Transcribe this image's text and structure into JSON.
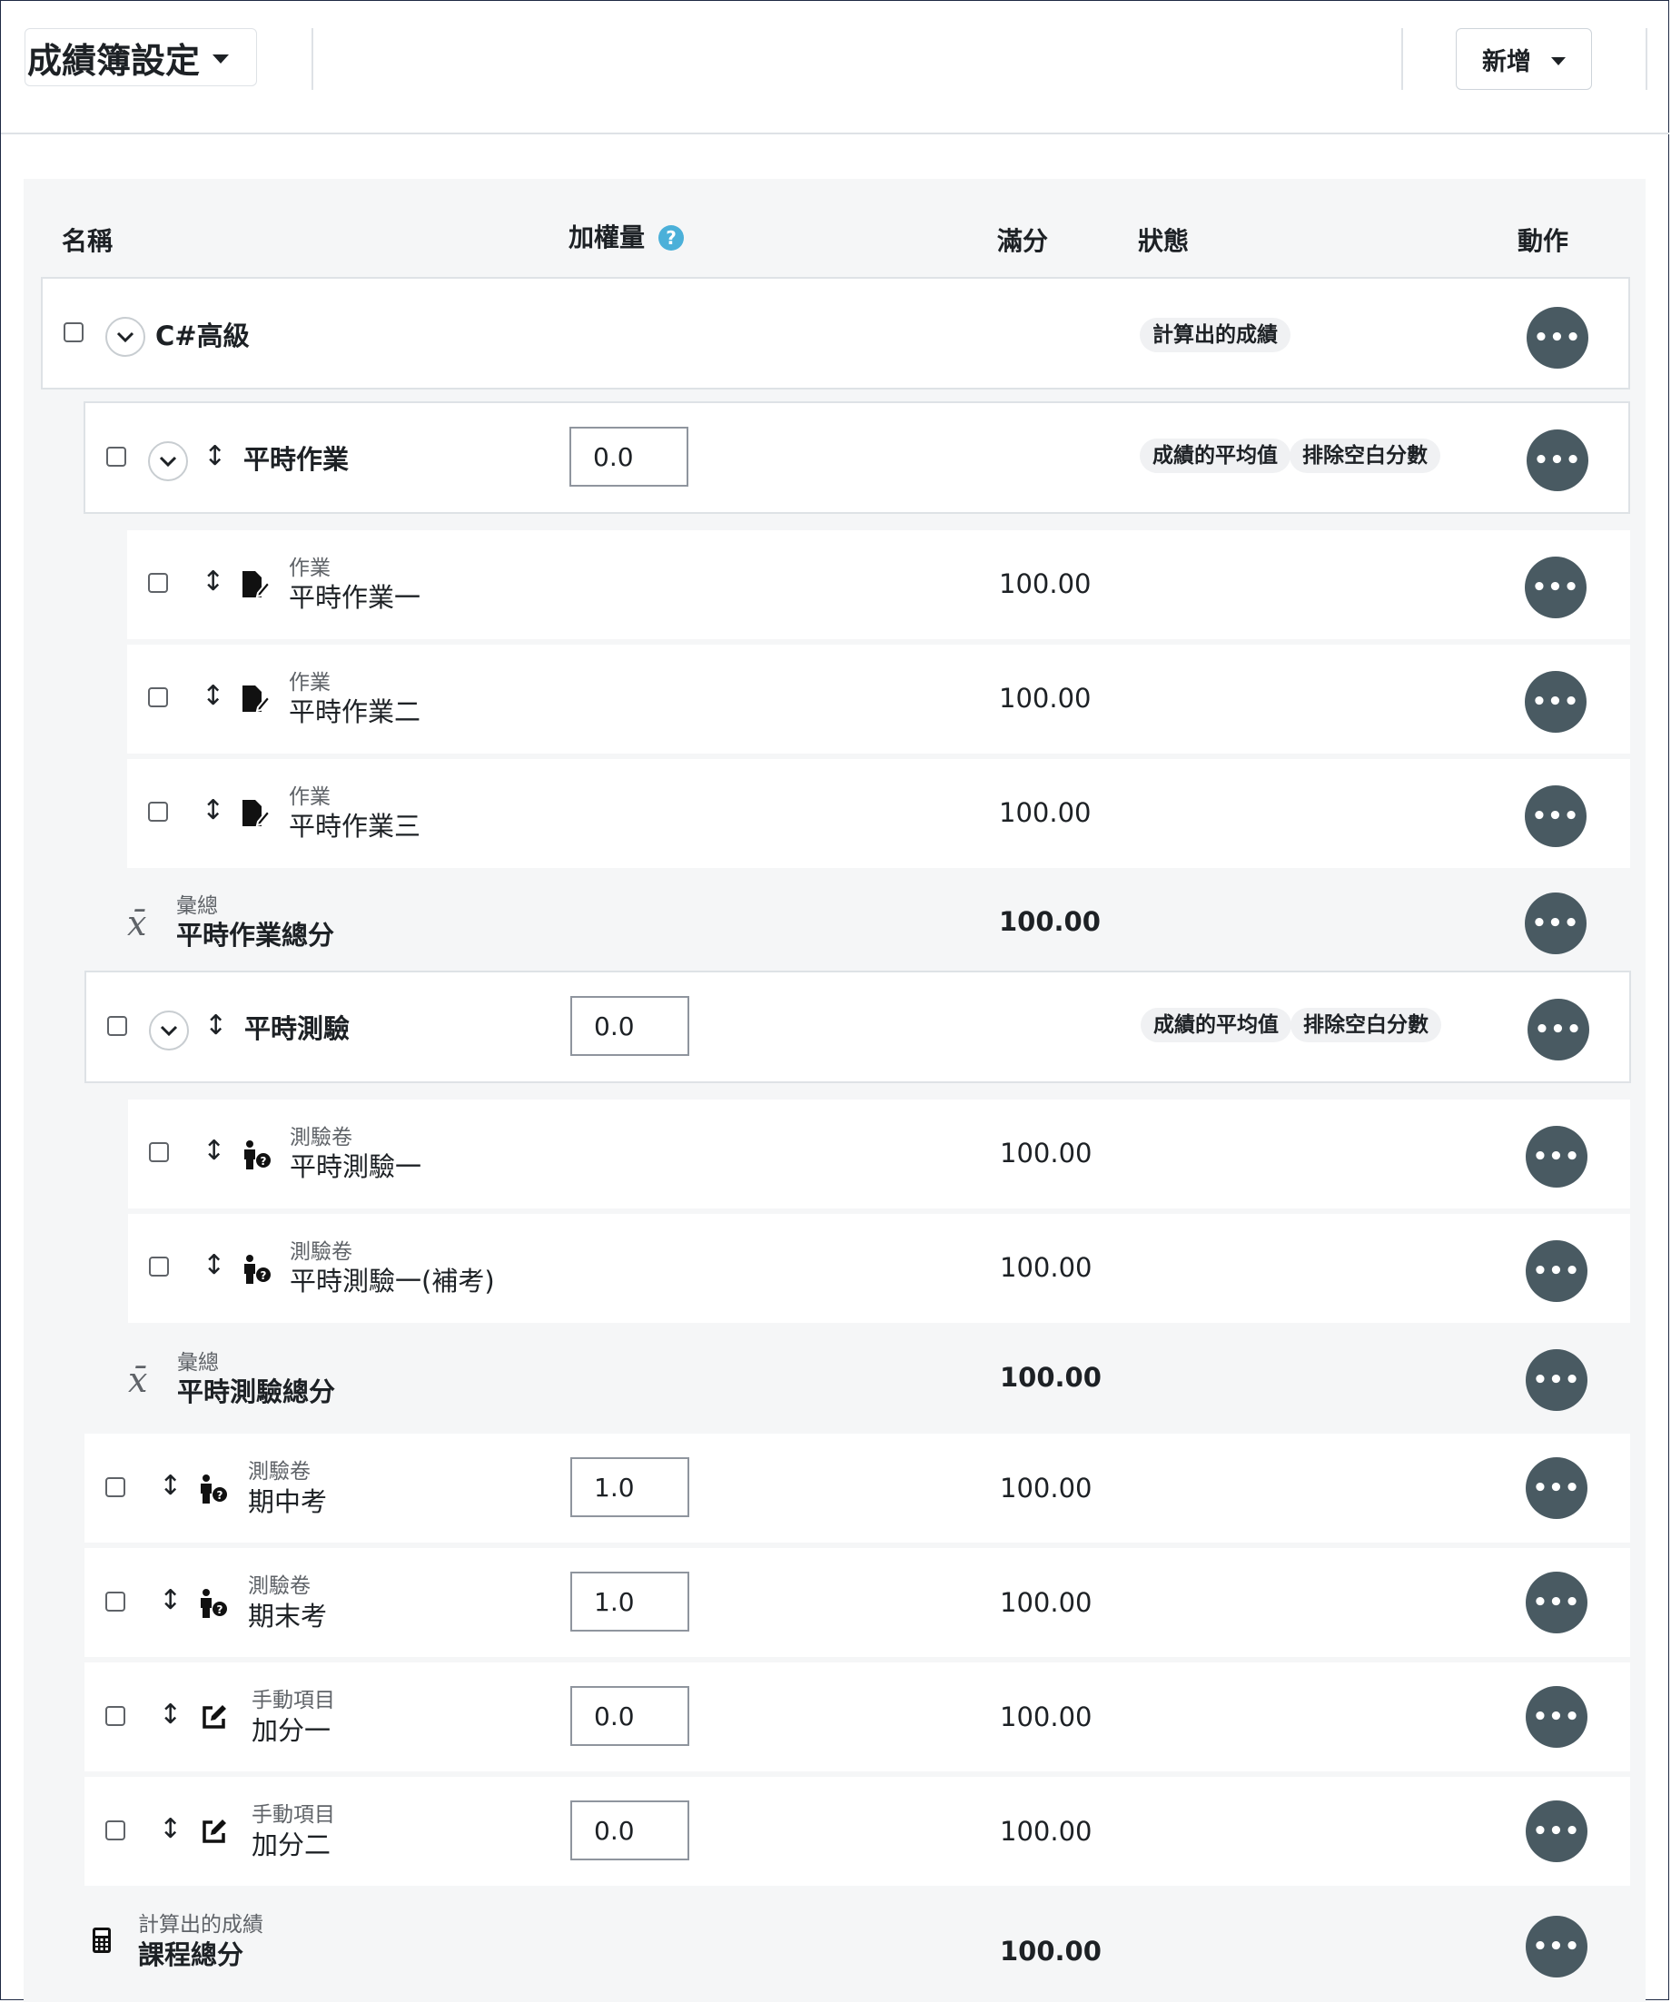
{
  "header": {
    "title": "成績簿設定",
    "add_button": "新增"
  },
  "columns": {
    "name": "名稱",
    "weight": "加權量",
    "max": "滿分",
    "status": "狀態",
    "actions": "動作",
    "help": "?"
  },
  "action_icon": "•••",
  "course": {
    "name": "C#高級",
    "status_badge": "計算出的成績"
  },
  "categories": [
    {
      "name": "平時作業",
      "weight": "0.0",
      "badges": [
        "成績的平均值",
        "排除空白分數"
      ],
      "items": [
        {
          "type": "作業",
          "name": "平時作業一",
          "max": "100.00",
          "icon": "assignment-icon"
        },
        {
          "type": "作業",
          "name": "平時作業二",
          "max": "100.00",
          "icon": "assignment-icon"
        },
        {
          "type": "作業",
          "name": "平時作業三",
          "max": "100.00",
          "icon": "assignment-icon"
        }
      ],
      "total": {
        "type": "彙總",
        "name": "平時作業總分",
        "max": "100.00",
        "icon": "mean-icon",
        "symbol": "x̄"
      }
    },
    {
      "name": "平時測驗",
      "weight": "0.0",
      "badges": [
        "成績的平均值",
        "排除空白分數"
      ],
      "items": [
        {
          "type": "測驗卷",
          "name": "平時測驗一",
          "max": "100.00",
          "icon": "quiz-icon"
        },
        {
          "type": "測驗卷",
          "name": "平時測驗一(補考)",
          "max": "100.00",
          "icon": "quiz-icon"
        }
      ],
      "total": {
        "type": "彙總",
        "name": "平時測驗總分",
        "max": "100.00",
        "icon": "mean-icon",
        "symbol": "x̄"
      }
    }
  ],
  "top_items": [
    {
      "type": "測驗卷",
      "name": "期中考",
      "weight": "1.0",
      "max": "100.00",
      "icon": "quiz-icon"
    },
    {
      "type": "測驗卷",
      "name": "期末考",
      "weight": "1.0",
      "max": "100.00",
      "icon": "quiz-icon"
    },
    {
      "type": "手動項目",
      "name": "加分一",
      "weight": "0.0",
      "max": "100.00",
      "icon": "manual-edit-icon"
    },
    {
      "type": "手動項目",
      "name": "加分二",
      "weight": "0.0",
      "max": "100.00",
      "icon": "manual-edit-icon"
    }
  ],
  "course_total": {
    "type": "計算出的成績",
    "name": "課程總分",
    "max": "100.00",
    "icon": "calculator-icon"
  }
}
